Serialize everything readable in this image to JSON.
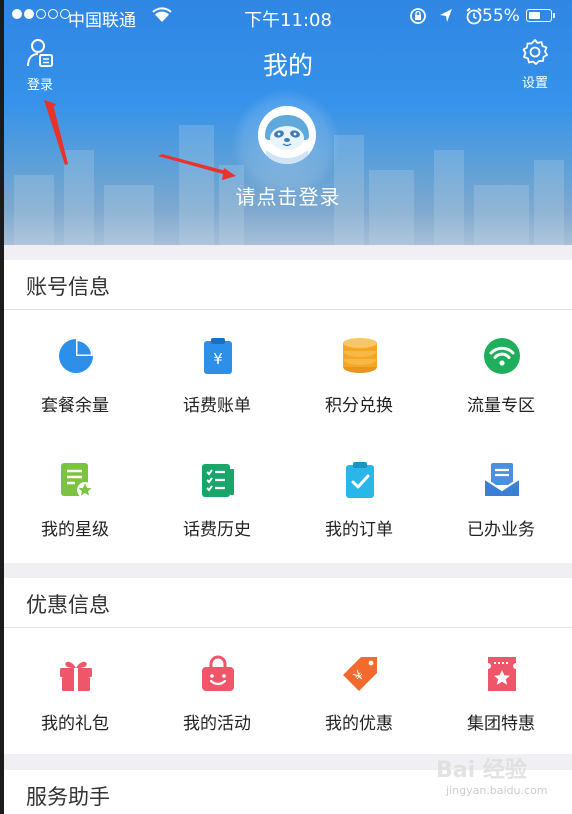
{
  "status_bar": {
    "carrier": "中国联通",
    "time": "下午11:08",
    "battery": "55%",
    "battery_level": 0.55,
    "signal_bars": 2
  },
  "header": {
    "title": "我的",
    "login_label": "登录",
    "settings_label": "设置",
    "login_prompt": "请点击登录"
  },
  "sections": [
    {
      "title": "账号信息",
      "items": [
        {
          "label": "套餐余量",
          "icon": "pie-chart-icon",
          "color": "#2d8fe8"
        },
        {
          "label": "话费账单",
          "icon": "bill-clipboard-icon",
          "color": "#2d8fe8"
        },
        {
          "label": "积分兑换",
          "icon": "coin-stack-icon",
          "color": "#f5a623"
        },
        {
          "label": "流量专区",
          "icon": "wifi-icon",
          "color": "#1fae5b"
        },
        {
          "label": "我的星级",
          "icon": "star-document-icon",
          "color": "#7cc33f"
        },
        {
          "label": "话费历史",
          "icon": "history-list-icon",
          "color": "#17a56a"
        },
        {
          "label": "我的订单",
          "icon": "order-clipboard-icon",
          "color": "#29b6e8"
        },
        {
          "label": "已办业务",
          "icon": "envelope-icon",
          "color": "#4a8fe0"
        }
      ]
    },
    {
      "title": "优惠信息",
      "items": [
        {
          "label": "我的礼包",
          "icon": "gift-icon",
          "color": "#f0566a"
        },
        {
          "label": "我的活动",
          "icon": "shopping-bag-icon",
          "color": "#f0566a"
        },
        {
          "label": "我的优惠",
          "icon": "price-tag-icon",
          "color": "#f36a2e"
        },
        {
          "label": "集团特惠",
          "icon": "ticket-star-icon",
          "color": "#f0566a"
        }
      ]
    },
    {
      "title": "服务助手",
      "items": []
    }
  ],
  "watermark": {
    "text": "Bai 经验",
    "url": "jingyan.baidu.com"
  }
}
